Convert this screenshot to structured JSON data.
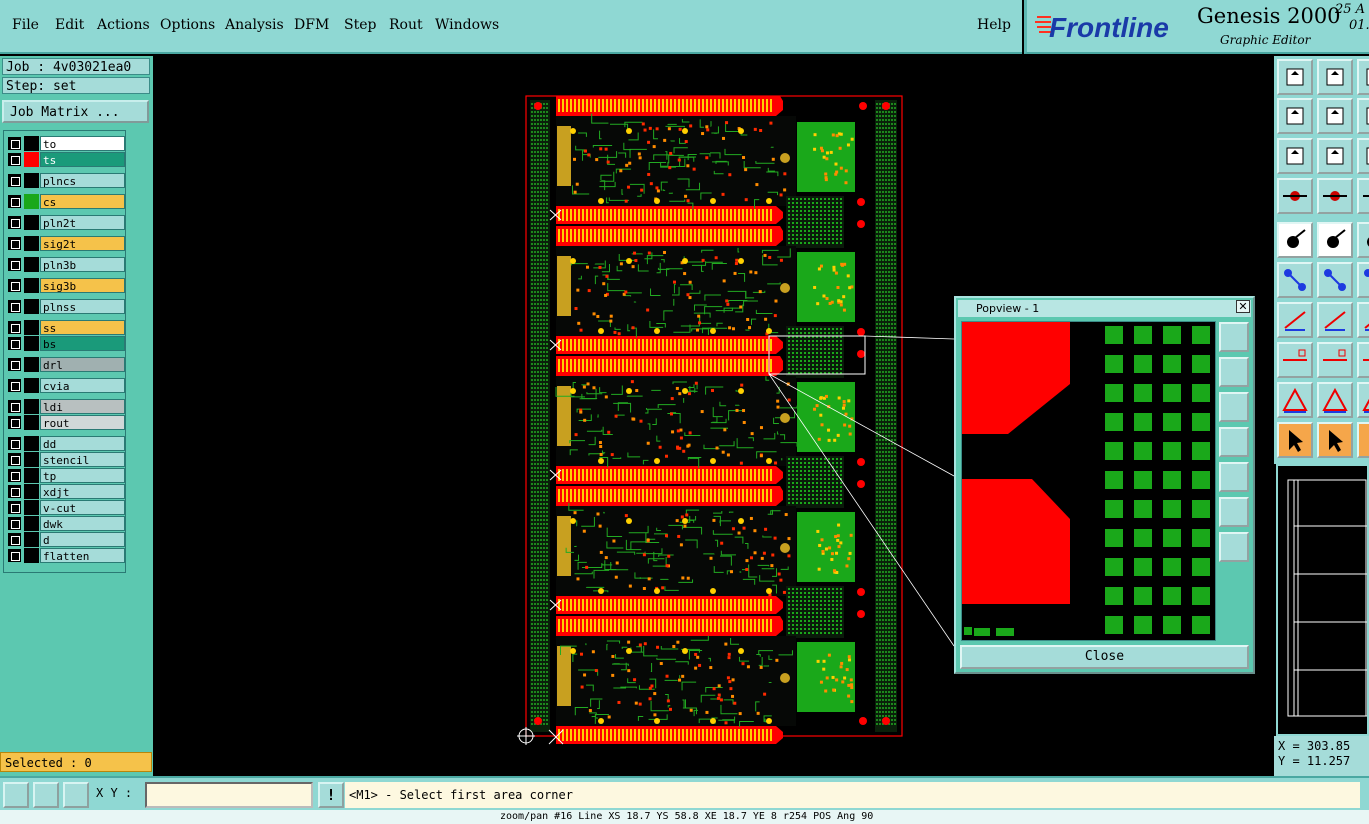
{
  "menu": {
    "items": [
      "File",
      "Edit",
      "Actions",
      "Options",
      "Analysis",
      "DFM",
      "Step",
      "Rout",
      "Windows"
    ],
    "help": "Help"
  },
  "brand": {
    "logo_text": "Frontline",
    "product": "Genesis 2000",
    "subtitle": "Graphic Editor",
    "date_line1": "25 A",
    "date_line2": "01."
  },
  "job": {
    "job_line": "Job : 4v03021ea0",
    "step_line": "Step: set",
    "matrix_button": "Job Matrix ..."
  },
  "layers": [
    {
      "name": "to",
      "color": "#ffffff",
      "swatch": "#000000"
    },
    {
      "name": "ts",
      "color": "#1a9a7a",
      "swatch": "#ff0000",
      "active": true
    },
    {
      "name": "plncs",
      "color": "#a5dcd9",
      "swatch": "#000000"
    },
    {
      "name": "cs",
      "color": "#f5c24a",
      "swatch": "#1aa81a"
    },
    {
      "name": "pln2t",
      "color": "#a5dcd9",
      "swatch": "#000000"
    },
    {
      "name": "sig2t",
      "color": "#f5c24a",
      "swatch": "#000000"
    },
    {
      "name": "pln3b",
      "color": "#a5dcd9",
      "swatch": "#000000"
    },
    {
      "name": "sig3b",
      "color": "#f5c24a",
      "swatch": "#000000"
    },
    {
      "name": "plnss",
      "color": "#a5dcd9",
      "swatch": "#000000"
    },
    {
      "name": "ss",
      "color": "#f5c24a",
      "swatch": "#000000"
    },
    {
      "name": "bs",
      "color": "#1a9a7a",
      "swatch": "#000000"
    },
    {
      "name": "drl",
      "color": "#a0b0b0",
      "swatch": "#000000"
    },
    {
      "name": "cvia",
      "color": "#a5dcd9",
      "swatch": "#000000"
    },
    {
      "name": "ldi",
      "color": "#b8c0c0",
      "swatch": "#000000"
    },
    {
      "name": "rout",
      "color": "#d0d8d8",
      "swatch": "#000000"
    },
    {
      "name": "dd",
      "color": "#a5dcd9",
      "swatch": "#000000"
    },
    {
      "name": "stencil",
      "color": "#a5dcd9",
      "swatch": "#000000"
    },
    {
      "name": "tp",
      "color": "#a5dcd9",
      "swatch": "#000000"
    },
    {
      "name": "xdjt",
      "color": "#a5dcd9",
      "swatch": "#000000"
    },
    {
      "name": "v-cut",
      "color": "#a5dcd9",
      "swatch": "#000000"
    },
    {
      "name": "dwk",
      "color": "#a5dcd9",
      "swatch": "#000000"
    },
    {
      "name": "d",
      "color": "#a5dcd9",
      "swatch": "#000000"
    },
    {
      "name": "flatten",
      "color": "#a5dcd9",
      "swatch": "#000000"
    }
  ],
  "selected": "Selected : 0",
  "bottom": {
    "xy_label": "X Y :",
    "xy_value": "",
    "warn_icon": "!",
    "status": "<M1> - Select first area corner"
  },
  "footer": "zoom/pan #16 Line XS 18.7 YS 58.8 XE 18.7 YE 8 r254 POS Ang 90",
  "coords": {
    "x": "X = 303.85",
    "y": "Y = 11.257"
  },
  "popview": {
    "title": "Popview - 1",
    "close_x": "✕",
    "close_button": "Close"
  },
  "colors": {
    "copper_red": "#ff0000",
    "pad_green": "#1aa81a",
    "trace_green": "#22aa22",
    "gold": "#c8a020",
    "teal_ui": "#8fd8d3"
  }
}
